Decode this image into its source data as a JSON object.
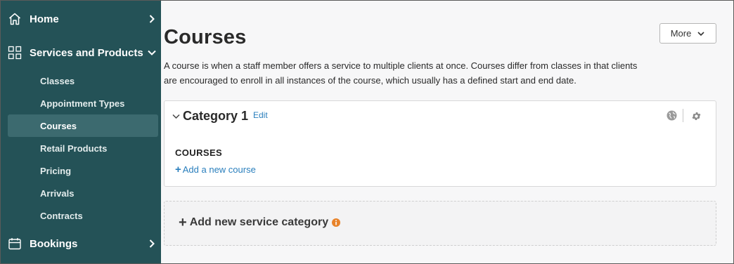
{
  "sidebar": {
    "home": {
      "label": "Home",
      "icon": "home-icon"
    },
    "services": {
      "label": "Services and Products",
      "icon": "grid-icon"
    },
    "sub_items": [
      {
        "label": "Classes",
        "active": false
      },
      {
        "label": "Appointment Types",
        "active": false
      },
      {
        "label": "Courses",
        "active": true
      },
      {
        "label": "Retail Products",
        "active": false
      },
      {
        "label": "Pricing",
        "active": false
      },
      {
        "label": "Arrivals",
        "active": false
      },
      {
        "label": "Contracts",
        "active": false
      }
    ],
    "bookings": {
      "label": "Bookings",
      "icon": "calendar-icon"
    }
  },
  "main": {
    "title": "Courses",
    "more_label": "More",
    "description_line1": "A course is when a staff member offers a service to multiple clients at once. Courses differ from classes in that clients",
    "description_line2": "are encouraged to enroll in all instances of the course, which usually has a defined start and end date.",
    "category": {
      "title": "Category 1",
      "edit_label": "Edit",
      "section_label": "COURSES",
      "add_course_label": "Add a new course"
    },
    "add_category_label": "Add new service category"
  },
  "colors": {
    "sidebar_bg": "#245257",
    "sidebar_active": "#3c6a6f",
    "link": "#2a7fbd",
    "info": "#e8832a"
  }
}
